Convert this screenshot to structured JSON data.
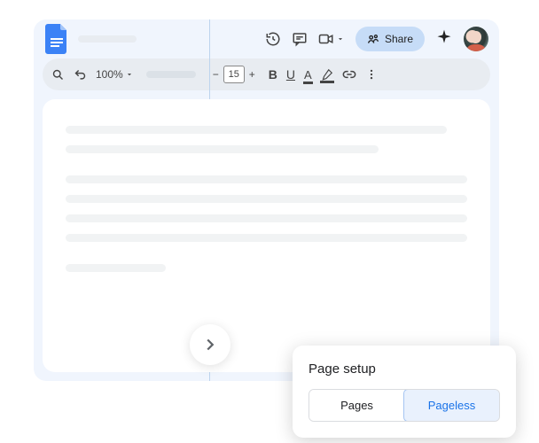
{
  "header": {
    "share_label": "Share"
  },
  "toolbar": {
    "zoom": "100%",
    "font_size": "15",
    "bold": "B",
    "underline": "U",
    "textcolor": "A"
  },
  "popup": {
    "title": "Page setup",
    "options": {
      "pages": "Pages",
      "pageless": "Pageless"
    }
  }
}
